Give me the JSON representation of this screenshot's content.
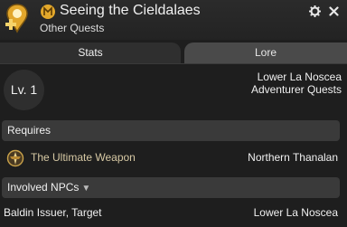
{
  "header": {
    "title": "Seeing the Cieldalaes",
    "subtitle": "Other Quests",
    "icons": {
      "quest": "quest-marker-plus-icon",
      "seal": "golden-seal-icon",
      "settings": "gear-icon",
      "close": "close-icon"
    }
  },
  "tabs": [
    {
      "label": "Stats",
      "active": true
    },
    {
      "label": "Lore",
      "active": false
    }
  ],
  "stats": {
    "level": "Lv. 1",
    "location_line1": "Lower La Noscea",
    "location_line2": "Adventurer Quests"
  },
  "requires": {
    "label": "Requires",
    "item": {
      "name": "The Ultimate Weapon",
      "location": "Northern Thanalan",
      "icon": "weapon-crest-icon"
    }
  },
  "involved_npcs": {
    "label": "Involved NPCs",
    "npc": {
      "name": "Baldin Issuer, Target",
      "location": "Lower La Noscea"
    }
  },
  "colors": {
    "background": "#1e1e1e",
    "section_bar": "#3a3a3a",
    "active_tab": "#2f2f2f",
    "inactive_tab": "#4a4a4a",
    "quest_name": "#d7c9a4",
    "accent_gold": "#e0a82a"
  }
}
